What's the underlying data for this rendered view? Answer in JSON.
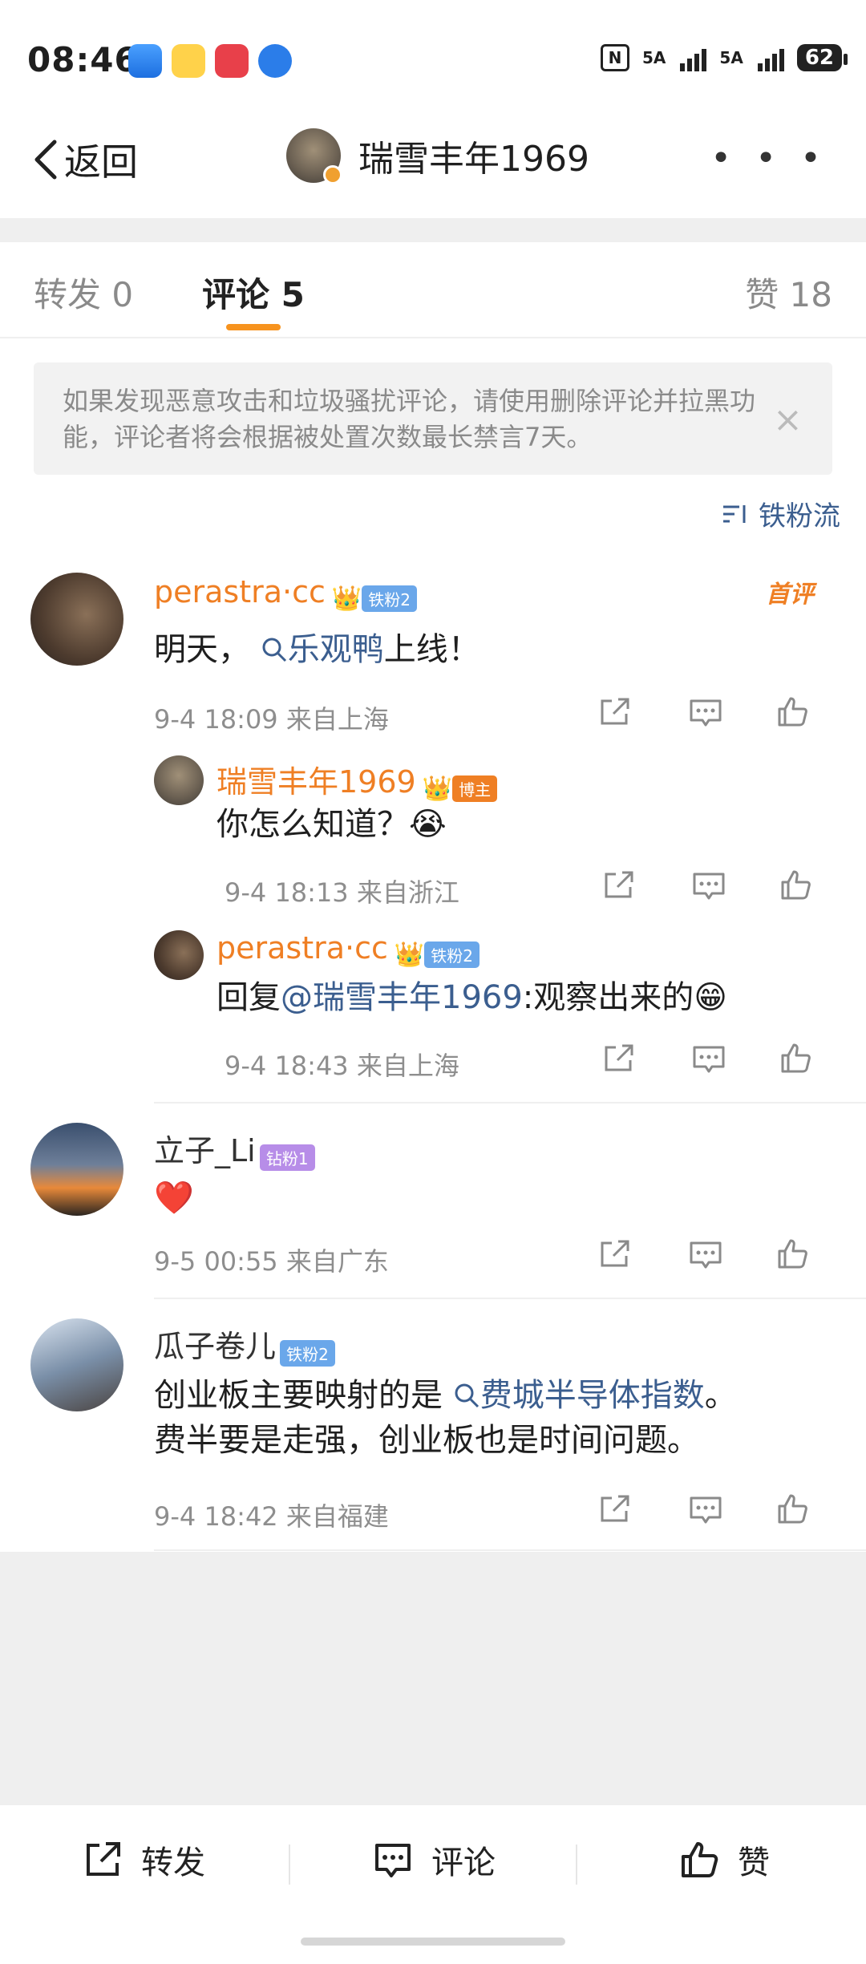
{
  "status_bar": {
    "time": "08:46",
    "net1": "5A",
    "net2": "5A",
    "battery": "62"
  },
  "nav": {
    "back_label": "返回",
    "title": "瑞雪丰年1969",
    "more": "• • •"
  },
  "tabs": {
    "repost": "转发 0",
    "comment": "评论 5",
    "like": "赞 18"
  },
  "notice": {
    "text": "如果发现恶意攻击和垃圾骚扰评论，请使用删除评论并拉黑功能，评论者将会根据被处置次数最长禁言7天。",
    "close": "×"
  },
  "sort_label": "铁粉流",
  "comments": [
    {
      "user": "perastra·cc",
      "badge": "铁粉2",
      "tag": "首评",
      "text_pre": "明天，",
      "topic": "乐观鸭",
      "text_post": "上线！",
      "meta": "9-4 18:09 来自上海",
      "replies": [
        {
          "user": "瑞雪丰年1969",
          "badge": "博主",
          "text": "你怎么知道？",
          "emoji": "😭",
          "meta": "9-4 18:13 来自浙江"
        },
        {
          "user": "perastra·cc",
          "badge": "铁粉2",
          "text_pre": "回复",
          "mention": "@瑞雪丰年1969",
          "text_post": ":观察出来的",
          "emoji": "😁",
          "meta": "9-4 18:43 来自上海"
        }
      ]
    },
    {
      "user": "立子_Li",
      "badge": "钻粉1",
      "text": "❤️",
      "meta": "9-5 00:55 来自广东"
    },
    {
      "user": "瓜子卷儿",
      "badge": "铁粉2",
      "text_pre": "创业板主要映射的是",
      "topic": "费城半导体指数",
      "text_post": "。",
      "text_line2": "费半要是走强，创业板也是时间问题。",
      "meta": "9-4 18:42 来自福建"
    }
  ],
  "bottom_bar": {
    "repost": "转发",
    "comment": "评论",
    "like": "赞"
  }
}
